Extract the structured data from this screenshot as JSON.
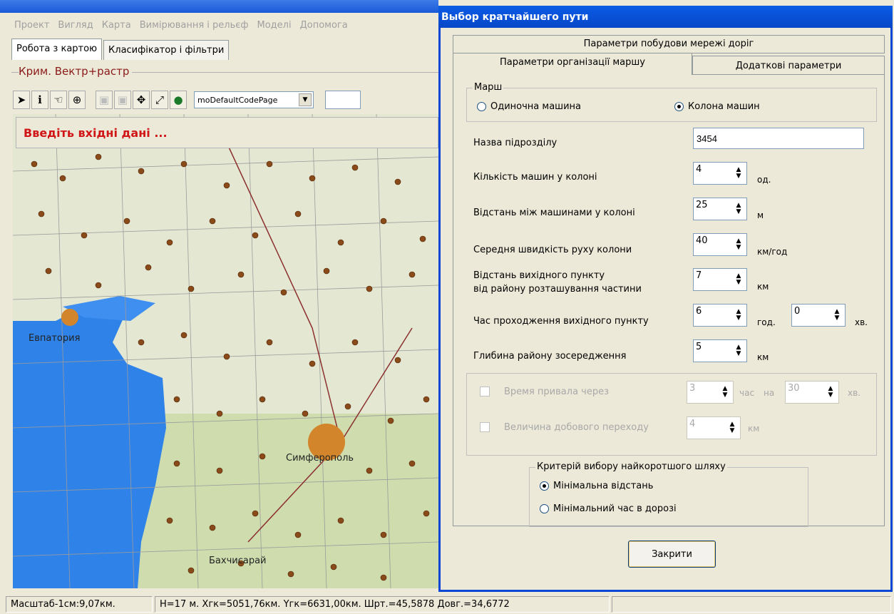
{
  "menu": [
    "Проект",
    "Вигляд",
    "Карта",
    "Вимірювання і рельєф",
    "Моделі",
    "Допомога"
  ],
  "left_tabs": [
    "Робота з картою",
    "Класифікатор і фільтри"
  ],
  "map_group_title": "Крим. Вектр+растр",
  "toolbar": {
    "codepage": "moDefaultCodePage"
  },
  "status_banner": "Введіть вхідні дані ...",
  "map_labels": {
    "city1": "Евпатория",
    "city2": "Симферополь",
    "city3": "Бахчисарай"
  },
  "statusbar": {
    "scale": "Масштаб-1см:9,07км.",
    "coords": "H=17 м. Xгк=5051,76км. Yгк=6631,00км. Шрт.=45,5878 Довг.=34,6772"
  },
  "dialog": {
    "title": "Выбор кратчайшего пути",
    "tab_network": "Параметри побудови мережі доріг",
    "tab_march": "Параметри організації маршу",
    "tab_extra": "Додаткові параметри",
    "march_group": "Марш",
    "radio_single": "Одиночна  машина",
    "radio_column": "Колона машин",
    "unit_name_label": "Назва підрозділу",
    "unit_name_value": "3454",
    "vehicles_label": "Кількість машин у колоні",
    "vehicles_value": "4",
    "vehicles_unit": "од.",
    "distance_label": "Відстань між машинами у колоні",
    "distance_value": "25",
    "distance_unit": "м",
    "speed_label": "Середня швидкість руху колони",
    "speed_value": "40",
    "speed_unit": "км/год",
    "start_dist_label1": "Відстань вихідного пункту",
    "start_dist_label2": "від району розташування частини",
    "start_dist_value": "7",
    "start_dist_unit": "км",
    "start_time_label": "Час проходження вихідного пункту",
    "start_time_h": "6",
    "start_time_h_unit": "год.",
    "start_time_m": "0",
    "start_time_m_unit": "хв.",
    "depth_label": "Глибина району зосередження",
    "depth_value": "5",
    "depth_unit": "км",
    "rest_label": "Время привала через",
    "rest_h": "3",
    "rest_h_unit": "час",
    "rest_on": "на",
    "rest_m": "30",
    "rest_m_unit": "хв.",
    "daily_label": "Величина добового переходу",
    "daily_value": "4",
    "daily_unit": "км",
    "criterion_group": "Критерій вибору найкоротшого шляху",
    "crit_distance": "Мінімальна відстань",
    "crit_time": "Мінімальний час в дорозі",
    "close_button": "Закрити"
  }
}
